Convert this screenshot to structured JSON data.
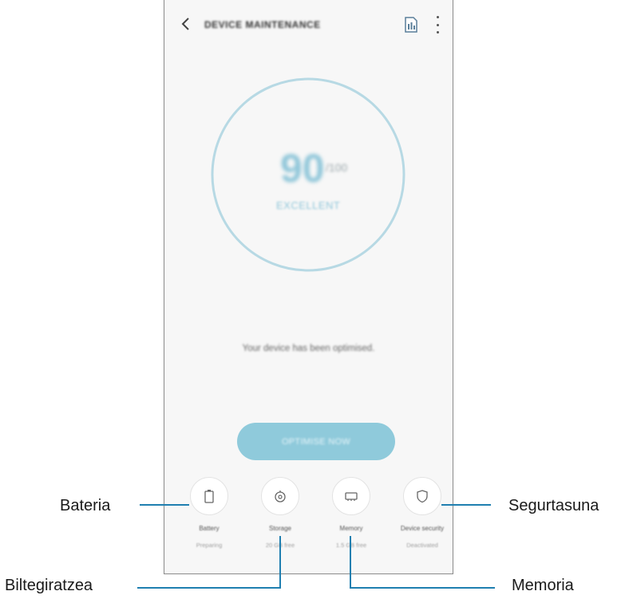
{
  "screen": {
    "title": "DEVICE MAINTENANCE",
    "score": "90",
    "score_max": "/100",
    "status": "EXCELLENT",
    "message": "Your device has been optimised.",
    "optimize_button": "OPTIMISE NOW",
    "tiles": [
      {
        "name": "Battery",
        "sub": "Preparing",
        "icon": "battery-icon"
      },
      {
        "name": "Storage",
        "sub": "20 GB free",
        "icon": "storage-icon"
      },
      {
        "name": "Memory",
        "sub": "1.5 GB free",
        "icon": "memory-icon"
      },
      {
        "name": "Device security",
        "sub": "Deactivated",
        "icon": "shield-icon"
      }
    ]
  },
  "callouts": {
    "battery": "Bateria",
    "storage": "Biltegiratzea",
    "memory": "Memoria",
    "security": "Segurtasuna"
  },
  "colors": {
    "accent": "#8fcadb",
    "leader_line": "#1f7fb0",
    "ring": "#b7d9e4"
  }
}
